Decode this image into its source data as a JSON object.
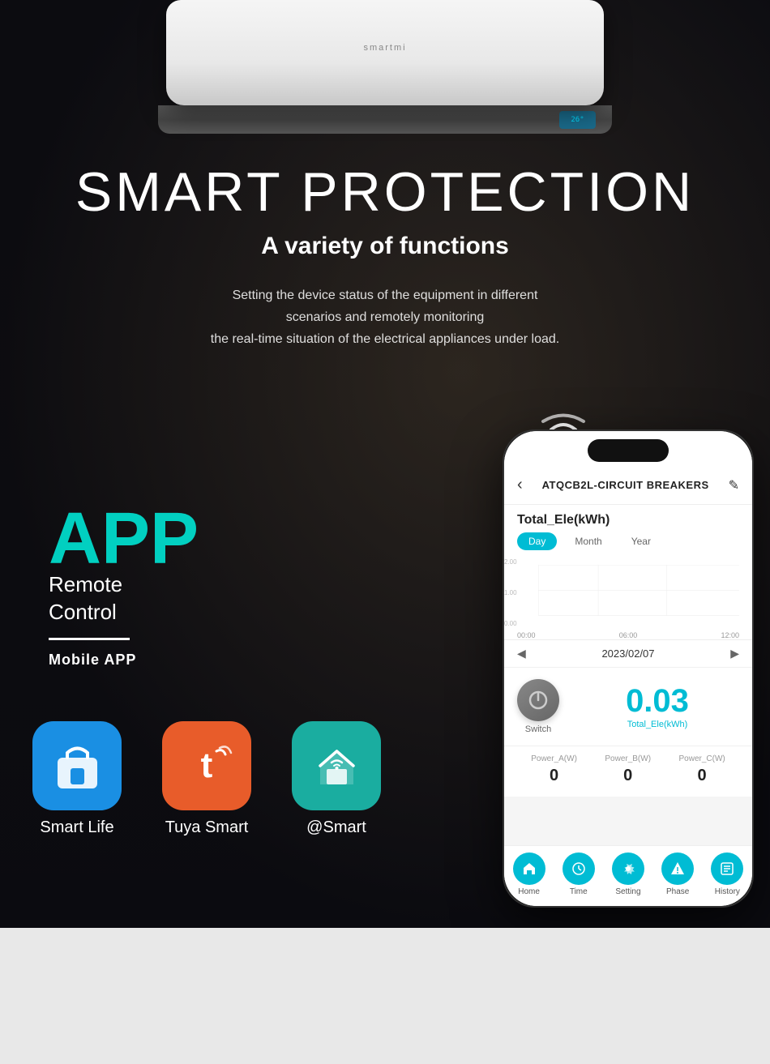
{
  "page": {
    "bg_color": "#1a1a1a"
  },
  "ac": {
    "brand": "smartmi",
    "display": "26°"
  },
  "hero": {
    "main_title": "SMART PROTECTION",
    "sub_title": "A variety of functions",
    "description": "Setting the device status of the equipment in different\nscenarios and remotely monitoring\nthe real-time situation of the electrical appliances under load."
  },
  "app_section": {
    "big_text": "APP",
    "line1": "Remote",
    "line2": "Control",
    "mobile_label": "Mobile APP"
  },
  "app_icons": [
    {
      "label": "Smart Life",
      "color_class": "icon-smart-life"
    },
    {
      "label": "Tuya Smart",
      "color_class": "icon-tuya"
    },
    {
      "label": "@Smart",
      "color_class": "icon-at-smart"
    }
  ],
  "phone": {
    "title": "ATQCB2L-CIRCUIT BREAKERS",
    "energy_label": "Total_Ele(kWh)",
    "tabs": [
      "Day",
      "Month",
      "Year"
    ],
    "active_tab": "Day",
    "chart_y": [
      "2.00",
      "1.00",
      "0.00"
    ],
    "chart_x": [
      "00:00",
      "06:00",
      "12:00"
    ],
    "date": "2023/02/07",
    "energy_value": "0.03",
    "energy_unit": "Total_Ele(kWh)",
    "switch_label": "Switch",
    "power_items": [
      {
        "label": "Power_A(W)",
        "value": "0"
      },
      {
        "label": "Power_B(W)",
        "value": "0"
      },
      {
        "label": "Power_C(W)",
        "value": "0"
      }
    ],
    "nav_items": [
      {
        "label": "Home",
        "icon": "home"
      },
      {
        "label": "Time",
        "icon": "time"
      },
      {
        "label": "Setting",
        "icon": "setting"
      },
      {
        "label": "Phase",
        "icon": "phase"
      },
      {
        "label": "History",
        "icon": "history"
      }
    ]
  }
}
